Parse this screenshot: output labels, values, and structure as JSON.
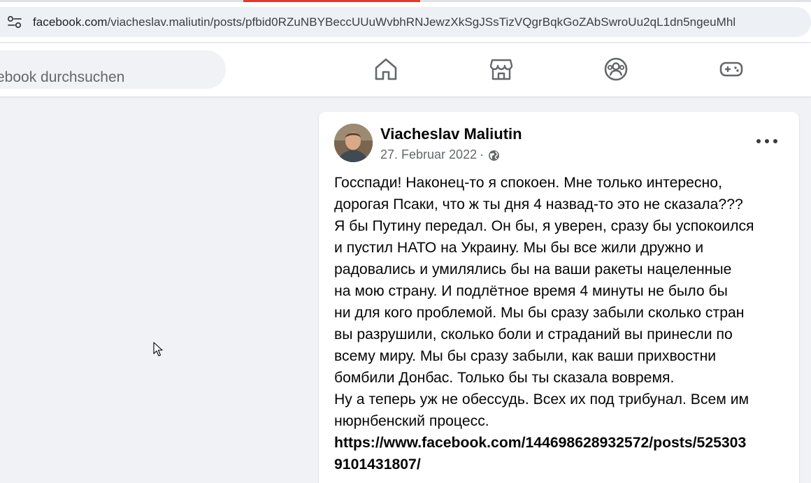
{
  "browser": {
    "url_host": "facebook.com",
    "url_path": "/viacheslav.maliutin/posts/pfbid0RZuNBYBeccUUuWvbhRNJewzXkSgJSsTizVQgrBqkGoZAbSwroUu2qL1dn5ngeuMhl",
    "site_info_icon": "tune-icon"
  },
  "nav": {
    "search_placeholder": "Facebook durchsuchen",
    "icons": [
      "home-icon",
      "marketplace-icon",
      "groups-icon",
      "gaming-icon"
    ]
  },
  "post": {
    "author": "Viacheslav Maliutin",
    "date": "27. Februar 2022",
    "separator": "·",
    "audience_icon": "globe-icon",
    "more_icon": "more-options-icon",
    "body_lines": [
      "Госспади! Наконец-то я спокоен. Мне только интересно,",
      "дорогая Псаки, что ж ты дня 4 назвад-то это не сказала???",
      "Я бы Путину передал. Он бы, я уверен, сразу бы успокоился",
      "и пустил НАТО на Украину. Мы бы все жили дружно и",
      "радовались и умилялись бы на ваши ракеты нацеленные",
      "на мою страну. И подлётное время 4 минуты не было бы",
      "ни для кого проблемой. Мы бы сразу забыли сколько стран",
      "вы разрушили, сколько боли и страданий вы принесли по",
      "всему миру. Мы бы сразу забыли, как ваши прихвостни",
      "бомбили Донбас. Только бы ты сказала вовремя.",
      "Ну а теперь уж не обессудь. Всех их под трибунал. Всем им",
      "нюрнбенский процесс."
    ],
    "link_lines": [
      "https://www.facebook.com/144698628932572/posts/525303",
      "9101431807/"
    ]
  },
  "colors": {
    "background": "#f0f2f5",
    "card": "#ffffff",
    "tab_accent": "#e03b2f",
    "icon": "#65676b"
  }
}
